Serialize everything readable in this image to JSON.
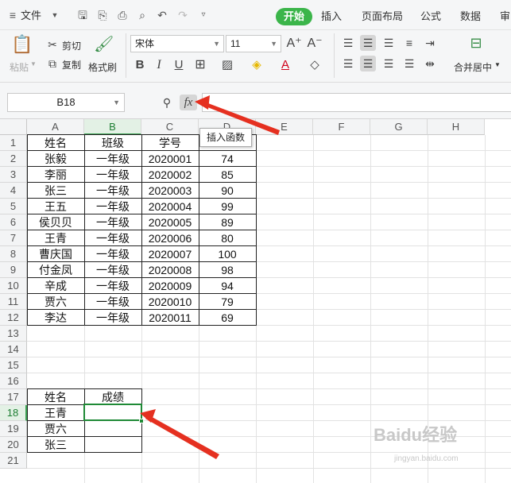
{
  "menu": {
    "file_label": "文件",
    "tabs": [
      {
        "label": "开始",
        "active": true
      },
      {
        "label": "插入"
      },
      {
        "label": "页面布局"
      },
      {
        "label": "公式"
      },
      {
        "label": "数据"
      },
      {
        "label": "审"
      }
    ]
  },
  "ribbon": {
    "paste_label": "粘贴",
    "cut_label": "剪切",
    "copy_label": "复制",
    "format_painter_label": "格式刷",
    "font_name": "宋体",
    "font_size": "11",
    "bold": "B",
    "italic": "I",
    "underline": "U",
    "merge_label": "合并居中"
  },
  "formula_bar": {
    "name_box": "B18",
    "fx_label": "fx",
    "tooltip": "插入函数",
    "formula": ""
  },
  "sheet": {
    "columns": [
      "A",
      "B",
      "C",
      "D",
      "E",
      "F",
      "G",
      "H"
    ],
    "selected_column": "B",
    "rows": [
      "1",
      "2",
      "3",
      "4",
      "5",
      "6",
      "7",
      "8",
      "9",
      "10",
      "11",
      "12",
      "13",
      "14",
      "15",
      "16",
      "17",
      "18",
      "19",
      "20",
      "21"
    ],
    "selected_row": "18",
    "table1": {
      "headers": [
        "姓名",
        "班级",
        "学号",
        ""
      ],
      "rows": [
        [
          "张毅",
          "一年级",
          "2020001",
          "74"
        ],
        [
          "李丽",
          "一年级",
          "2020002",
          "85"
        ],
        [
          "张三",
          "一年级",
          "2020003",
          "90"
        ],
        [
          "王五",
          "一年级",
          "2020004",
          "99"
        ],
        [
          "侯贝贝",
          "一年级",
          "2020005",
          "89"
        ],
        [
          "王青",
          "一年级",
          "2020006",
          "80"
        ],
        [
          "曹庆国",
          "一年级",
          "2020007",
          "100"
        ],
        [
          "付金凤",
          "一年级",
          "2020008",
          "98"
        ],
        [
          "辛成",
          "一年级",
          "2020009",
          "94"
        ],
        [
          "贾六",
          "一年级",
          "2020010",
          "79"
        ],
        [
          "李达",
          "一年级",
          "2020011",
          "69"
        ]
      ]
    },
    "table2": {
      "headers": [
        "姓名",
        "成绩"
      ],
      "rows": [
        [
          "王青",
          ""
        ],
        [
          "贾六",
          ""
        ],
        [
          "张三",
          ""
        ]
      ]
    }
  },
  "colors": {
    "accent": "#3bb54a",
    "selection": "#1f8a36",
    "arrow": "#e53020"
  },
  "watermark": {
    "brand": "Baidu经验",
    "url": "jingyan.baidu.com"
  }
}
